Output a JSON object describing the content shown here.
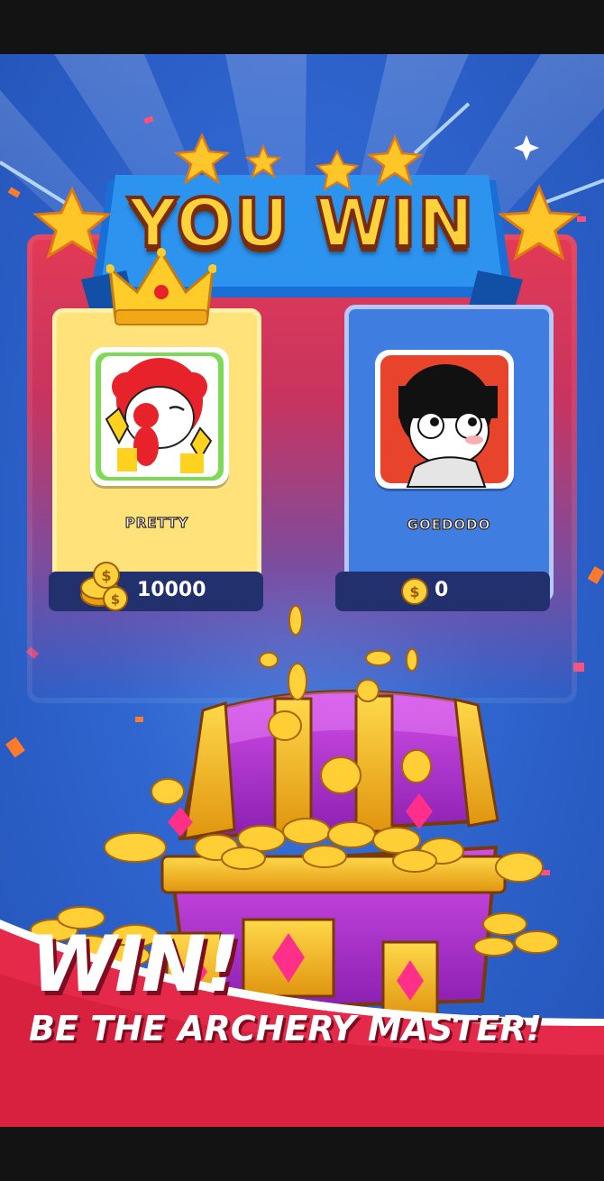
{
  "title": "YOU WIN",
  "players": [
    {
      "name": "PRETTY",
      "coins": "10000",
      "winner": true,
      "card_color": "#ffe27a"
    },
    {
      "name": "GOEDODO",
      "coins": "0",
      "winner": false,
      "card_color": "#3f7de0"
    }
  ],
  "footer": {
    "headline": "WIN!",
    "tagline": "BE THE ARCHERY MASTER!"
  },
  "icons": [
    "star-icon",
    "crown-icon",
    "coin-icon",
    "treasure-chest-icon"
  ],
  "colors": {
    "background": "#2f66cf",
    "banner_blue": "#1f8be0",
    "title_gold": "#ffd23c",
    "footer_red": "#d8203f",
    "chest_purple": "#b02fd0",
    "chest_gold": "#f2b21c"
  }
}
